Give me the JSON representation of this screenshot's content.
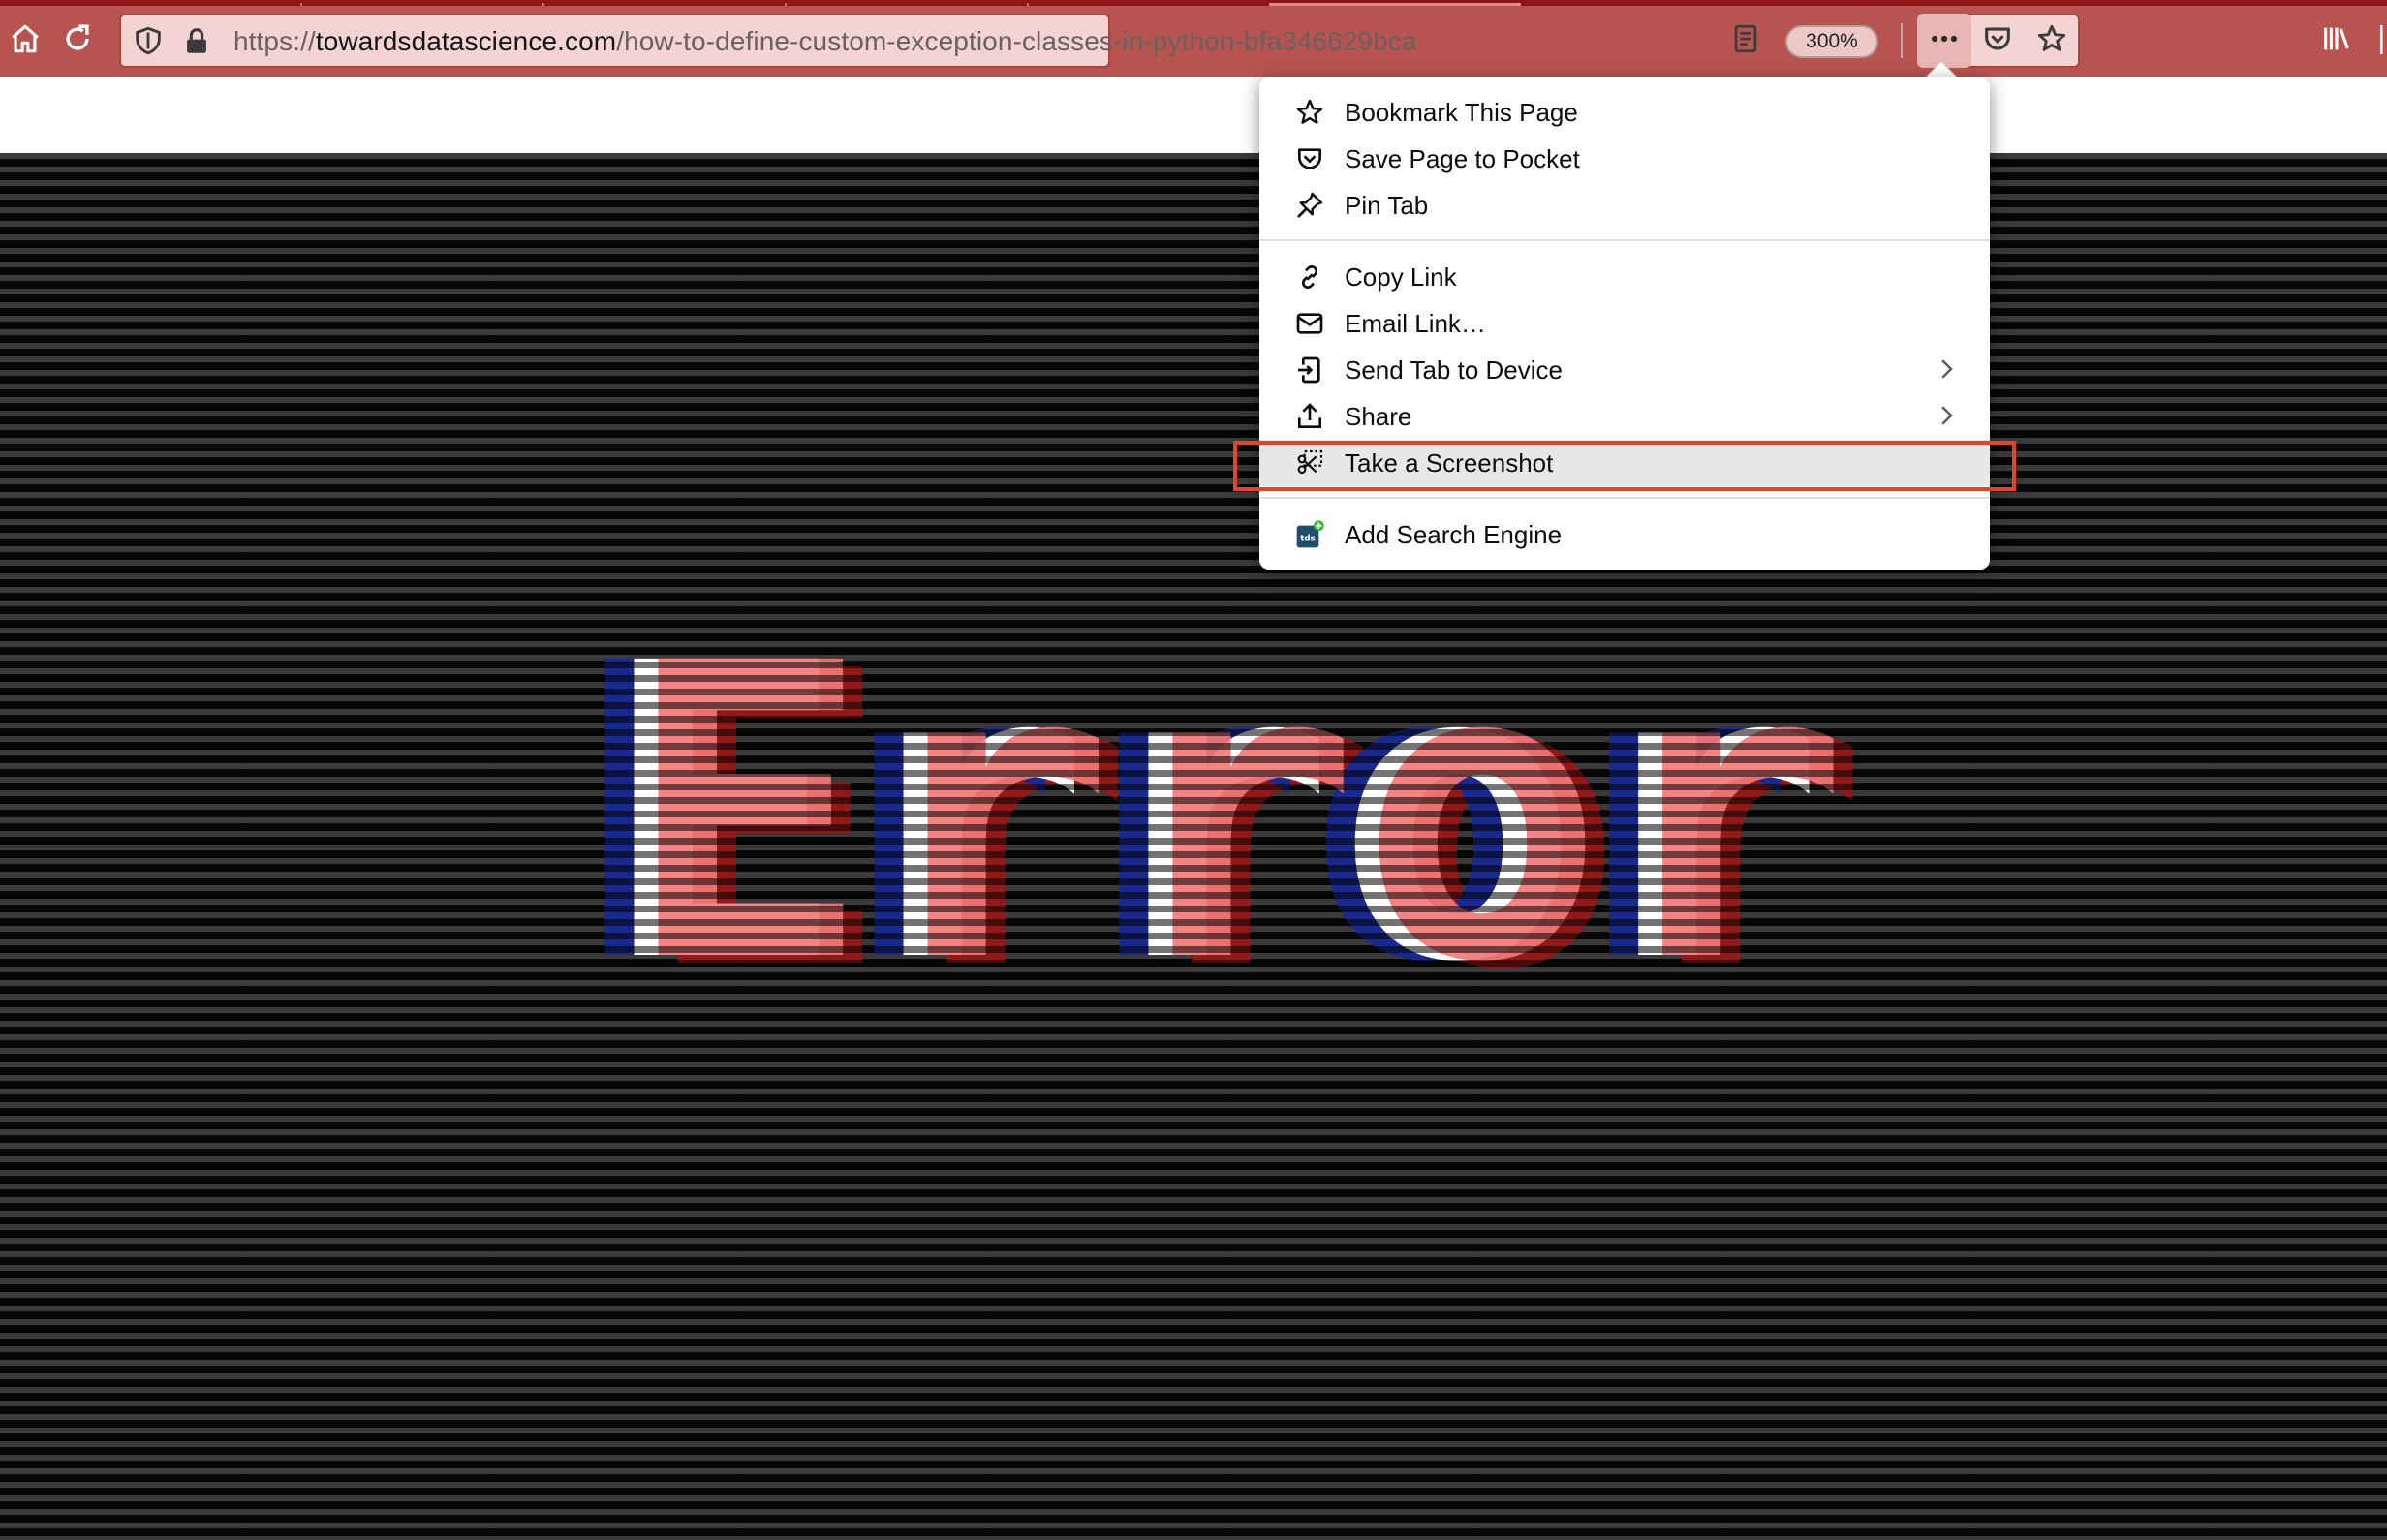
{
  "browser": {
    "url_scheme": "https://",
    "url_host": "towardsdatascience.com",
    "url_path": "/how-to-define-custom-exception-classes-in-python-bfa346629bca",
    "zoom_level": "300%",
    "toolbar_color": "#b85450",
    "icons": {
      "home": "home-icon",
      "reload": "reload-icon",
      "tracking": "shield-icon",
      "lock": "lock-icon",
      "reader": "reader-view-icon",
      "page_actions": "ellipsis-icon",
      "pocket": "pocket-icon",
      "bookmark": "star-icon",
      "library": "library-icon"
    }
  },
  "page_menu": {
    "items": [
      {
        "label": "Bookmark This Page",
        "icon": "star-icon"
      },
      {
        "label": "Save Page to Pocket",
        "icon": "pocket-icon"
      },
      {
        "label": "Pin Tab",
        "icon": "pin-icon"
      },
      {
        "label": "Copy Link",
        "icon": "link-icon"
      },
      {
        "label": "Email Link…",
        "icon": "mail-icon"
      },
      {
        "label": "Send Tab to Device",
        "icon": "send-tab-icon",
        "submenu": true
      },
      {
        "label": "Share",
        "icon": "share-icon",
        "submenu": true
      },
      {
        "label": "Take a Screenshot",
        "icon": "screenshot-icon",
        "highlighted": true
      },
      {
        "label": "Add Search Engine",
        "icon": "search-engine-icon",
        "badge_text": "tds"
      }
    ],
    "highlight_color": "#e2462a"
  },
  "page": {
    "error_text": "Error",
    "art_colors": [
      "#1a2a8c",
      "#ffffff",
      "#f07a7a",
      "#8e1a1a"
    ]
  }
}
